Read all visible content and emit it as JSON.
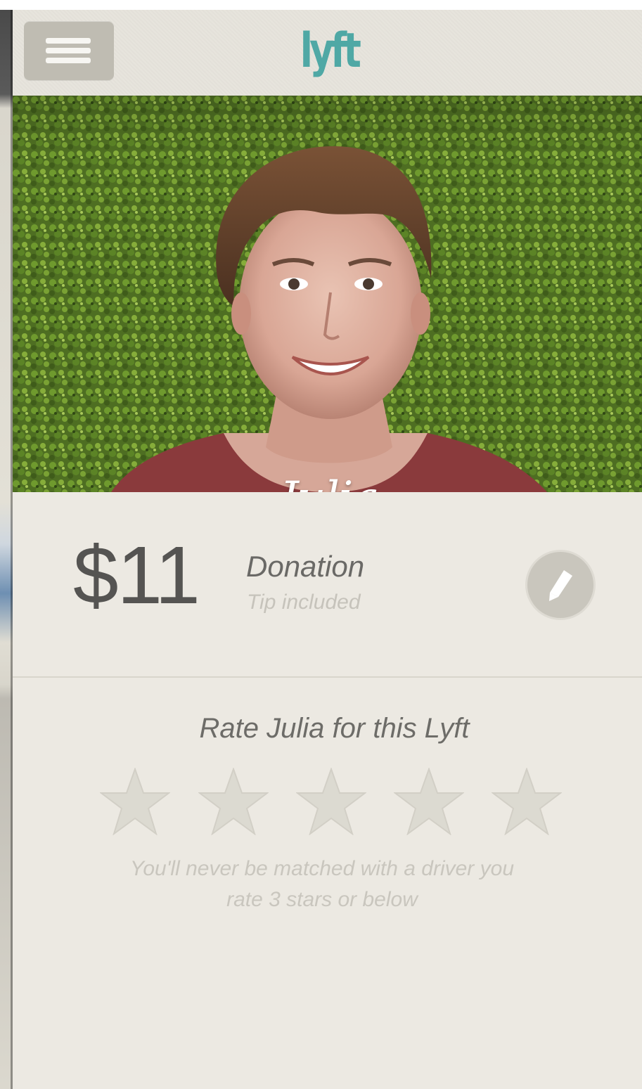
{
  "app": {
    "logo_text": "lyft",
    "brand_color": "#4fa8a5"
  },
  "header": {
    "menu_icon": "hamburger-icon"
  },
  "driver": {
    "name": "Julia"
  },
  "fare": {
    "amount": "$11",
    "type": "Donation",
    "note": "Tip included",
    "edit_icon": "pencil-icon"
  },
  "rating": {
    "title": "Rate Julia for this Lyft",
    "max_stars": 5,
    "selected_stars": 0,
    "note_line1": "You'll never be matched with a driver you",
    "note_line2": "rate 3 stars or below",
    "star_color": "#dcdad1"
  }
}
